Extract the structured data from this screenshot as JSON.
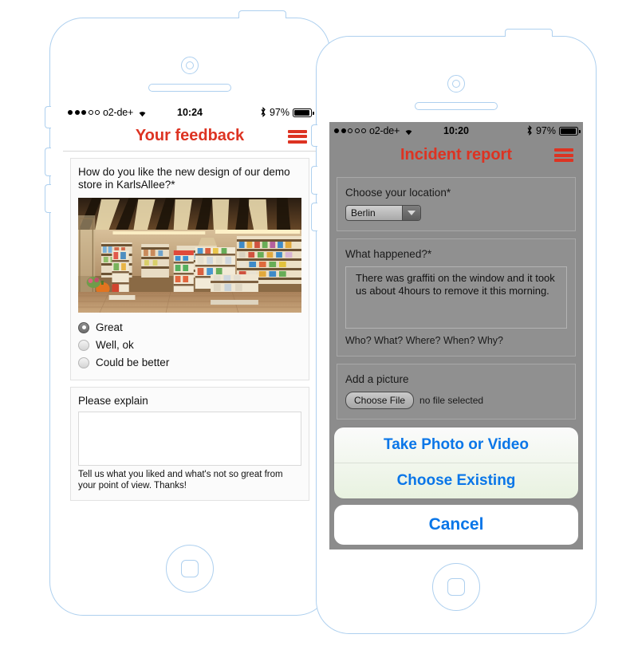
{
  "theme": {
    "accent_red": "#dd3322",
    "action_blue": "#0a76e8",
    "phone_outline": "#aed0ef",
    "right_screen_bg": "#8c8c8c"
  },
  "left_phone": {
    "status_bar": {
      "signal_dots_filled": 3,
      "signal_dots_total": 5,
      "carrier": "o2-de+",
      "wifi_icon": "wifi-icon",
      "time": "10:24",
      "bluetooth_icon": "bluetooth-icon",
      "battery_percent": "97%",
      "battery_level": 97
    },
    "navbar": {
      "title": "Your feedback",
      "menu_icon": "hamburger-menu-icon"
    },
    "question_card": {
      "question": "How do you like the new design of our demo store in KarlsAllee?*",
      "photo_alt": "store-interior-photo",
      "options": [
        {
          "label": "Great",
          "selected": true
        },
        {
          "label": "Well, ok",
          "selected": false
        },
        {
          "label": "Could be better",
          "selected": false
        }
      ]
    },
    "explain_card": {
      "label": "Please explain",
      "value": "",
      "placeholder": "",
      "hint": "Tell us what you liked and what's not so great from your point of view. Thanks!"
    }
  },
  "right_phone": {
    "status_bar": {
      "signal_dots_filled": 2,
      "signal_dots_total": 5,
      "carrier": "o2-de+",
      "wifi_icon": "wifi-icon",
      "time": "10:20",
      "bluetooth_icon": "bluetooth-icon",
      "battery_percent": "97%",
      "battery_level": 97
    },
    "navbar": {
      "title": "Incident report",
      "menu_icon": "hamburger-menu-icon"
    },
    "location_card": {
      "label": "Choose your location*",
      "selected": "Berlin",
      "dropdown_icon": "chevron-down-icon"
    },
    "incident_card": {
      "label": "What happened?*",
      "value": "There was graffiti on the window and it took us about 4hours to remove it this morning.",
      "hint": "Who? What? Where? When? Why?"
    },
    "picture_card": {
      "label": "Add a picture",
      "button_label": "Choose File",
      "file_status": "no file selected"
    },
    "action_sheet": {
      "options": [
        "Take Photo or Video",
        "Choose Existing"
      ],
      "cancel_label": "Cancel"
    }
  }
}
